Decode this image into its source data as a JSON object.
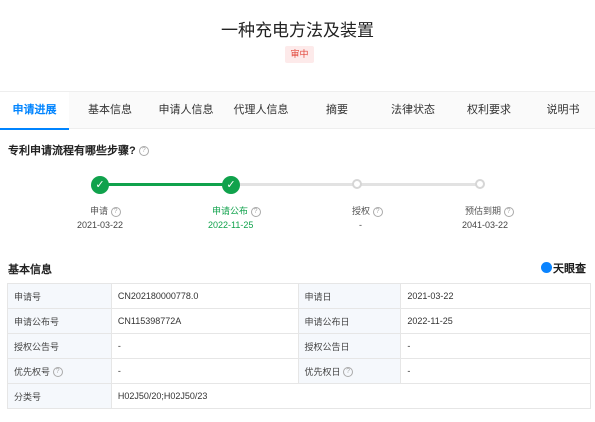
{
  "header": {
    "title": "一种充电方法及装置",
    "status_badge": "审中"
  },
  "tabs": [
    "申请进展",
    "基本信息",
    "申请人信息",
    "代理人信息",
    "摘要",
    "法律状态",
    "权利要求",
    "说明书"
  ],
  "active_tab": "申请进展",
  "process": {
    "question": "专利申请流程有哪些步骤?",
    "steps": [
      {
        "label": "申请",
        "date": "2021-03-22",
        "state": "done"
      },
      {
        "label": "申请公布",
        "date": "2022-11-25",
        "state": "done"
      },
      {
        "label": "授权",
        "date": "-",
        "state": "pending"
      },
      {
        "label": "预估到期",
        "date": "2041-03-22",
        "state": "pending"
      }
    ]
  },
  "basic_info": {
    "title": "基本信息",
    "logo_text": "天眼查",
    "rows": [
      {
        "k1": "申请号",
        "v1": "CN202180000778.0",
        "k2": "申请日",
        "v2": "2021-03-22"
      },
      {
        "k1": "申请公布号",
        "v1": "CN115398772A",
        "k2": "申请公布日",
        "v2": "2022-11-25"
      },
      {
        "k1": "授权公告号",
        "v1": "-",
        "k2": "授权公告日",
        "v2": "-"
      },
      {
        "k1": "优先权号",
        "v1": "-",
        "k2": "优先权日",
        "v2": "-"
      },
      {
        "k1": "分类号",
        "v1": "H02J50/20;H02J50/23"
      }
    ]
  },
  "colors": {
    "accent": "#0084ff",
    "success": "#10a24c",
    "badge_bg": "#fdeaea",
    "badge_text": "#e2463b"
  }
}
